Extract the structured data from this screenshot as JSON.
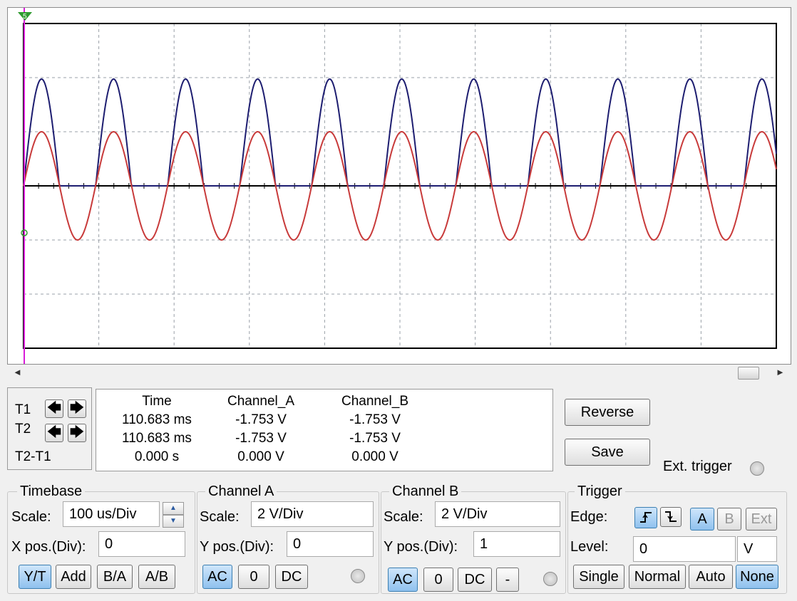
{
  "display": {
    "channel_a_color": "#3a3acb",
    "channel_b_color": "#1a1a5e",
    "trace_red": "#c83a3a",
    "trace_blue": "#1d1d70",
    "cursor_color": "#d81bd8",
    "trigger_marker": "5"
  },
  "scrollbar": {
    "left_arrow": "◄",
    "right_arrow": "►"
  },
  "cursors": {
    "t1_label": "T1",
    "t2_label": "T2",
    "diff_label": "T2-T1",
    "left_icon": "arrow-left-icon",
    "right_icon": "arrow-right-icon"
  },
  "readout": {
    "headers": [
      "Time",
      "Channel_A",
      "Channel_B"
    ],
    "rows": [
      [
        "110.683 ms",
        "-1.753 V",
        "-1.753 V"
      ],
      [
        "110.683 ms",
        "-1.753 V",
        "-1.753 V"
      ],
      [
        "0.000 s",
        "0.000 V",
        "0.000 V"
      ]
    ]
  },
  "actions": {
    "reverse": "Reverse",
    "save": "Save",
    "ext_trigger": "Ext. trigger"
  },
  "timebase": {
    "title": "Timebase",
    "scale_label": "Scale:",
    "scale_value": "100 us/Div",
    "xpos_label": "X pos.(Div):",
    "xpos_value": "0",
    "modes": [
      "Y/T",
      "Add",
      "B/A",
      "A/B"
    ]
  },
  "channel_a": {
    "title": "Channel A",
    "scale_label": "Scale:",
    "scale_value": "2  V/Div",
    "ypos_label": "Y pos.(Div):",
    "ypos_value": "0",
    "couplings": [
      "AC",
      "0",
      "DC"
    ]
  },
  "channel_b": {
    "title": "Channel B",
    "scale_label": "Scale:",
    "scale_value": "2  V/Div",
    "ypos_label": "Y pos.(Div):",
    "ypos_value": "1",
    "couplings": [
      "AC",
      "0",
      "DC",
      "-"
    ]
  },
  "trigger": {
    "title": "Trigger",
    "edge_label": "Edge:",
    "sources": [
      "A",
      "B",
      "Ext"
    ],
    "level_label": "Level:",
    "level_value": "0",
    "level_unit": "V",
    "modes": [
      "Single",
      "Normal",
      "Auto",
      "None"
    ]
  }
}
